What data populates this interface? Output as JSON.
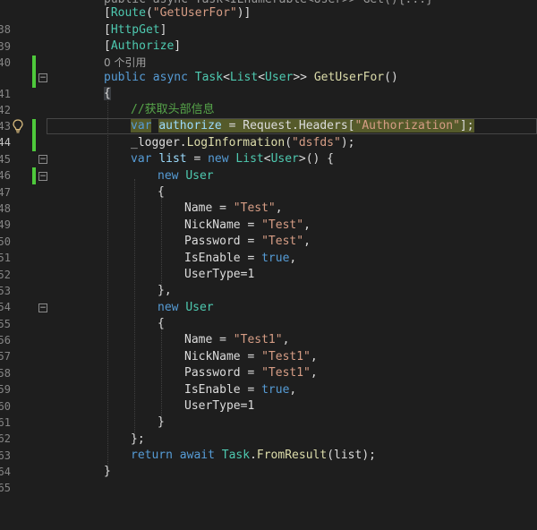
{
  "editor": {
    "top_partial": "public async Task<IEnumerable<User>> Get(){...}",
    "lines": [
      {
        "n": "38",
        "text": "[Route(\"GetUserFor\")]"
      },
      {
        "n": "39",
        "text": "[HttpGet]"
      },
      {
        "n": "40",
        "text": "[Authorize]"
      },
      {
        "n": "",
        "text": "0 个引用"
      },
      {
        "n": "41",
        "text": "public async Task<List<User>> GetUserFor()"
      },
      {
        "n": "42",
        "text": "{"
      },
      {
        "n": "43",
        "text": "//获取头部信息"
      },
      {
        "n": "44",
        "text": "var authorize = Request.Headers[\"Authorization\"];"
      },
      {
        "n": "45",
        "text": "_logger.LogInformation(\"dsfds\");"
      },
      {
        "n": "46",
        "text": "var list = new List<User>() {"
      },
      {
        "n": "47",
        "text": "new User"
      },
      {
        "n": "48",
        "text": "{"
      },
      {
        "n": "49",
        "text": "Name = \"Test\","
      },
      {
        "n": "50",
        "text": "NickName = \"Test\","
      },
      {
        "n": "51",
        "text": "Password = \"Test\","
      },
      {
        "n": "52",
        "text": "IsEnable = true,"
      },
      {
        "n": "53",
        "text": "UserType=1"
      },
      {
        "n": "54",
        "text": "},"
      },
      {
        "n": "55",
        "text": "new User"
      },
      {
        "n": "56",
        "text": "{"
      },
      {
        "n": "57",
        "text": "Name = \"Test1\","
      },
      {
        "n": "58",
        "text": "NickName = \"Test1\","
      },
      {
        "n": "59",
        "text": "Password = \"Test1\","
      },
      {
        "n": "60",
        "text": "IsEnable = true,"
      },
      {
        "n": "61",
        "text": "UserType=1"
      },
      {
        "n": "62",
        "text": "}"
      },
      {
        "n": "63",
        "text": "};"
      },
      {
        "n": "64",
        "text": "return await Task.FromResult(list);"
      },
      {
        "n": "65",
        "text": "}"
      }
    ]
  },
  "icons": {
    "lightbulb": "lightbulb-icon",
    "fold": "collapse-icon"
  },
  "colors": {
    "background": "#1e1e1e",
    "keyword": "#569cd6",
    "type": "#4ec9b0",
    "string": "#d69d85",
    "comment": "#57a64a",
    "change_bar": "#4ec93b"
  }
}
